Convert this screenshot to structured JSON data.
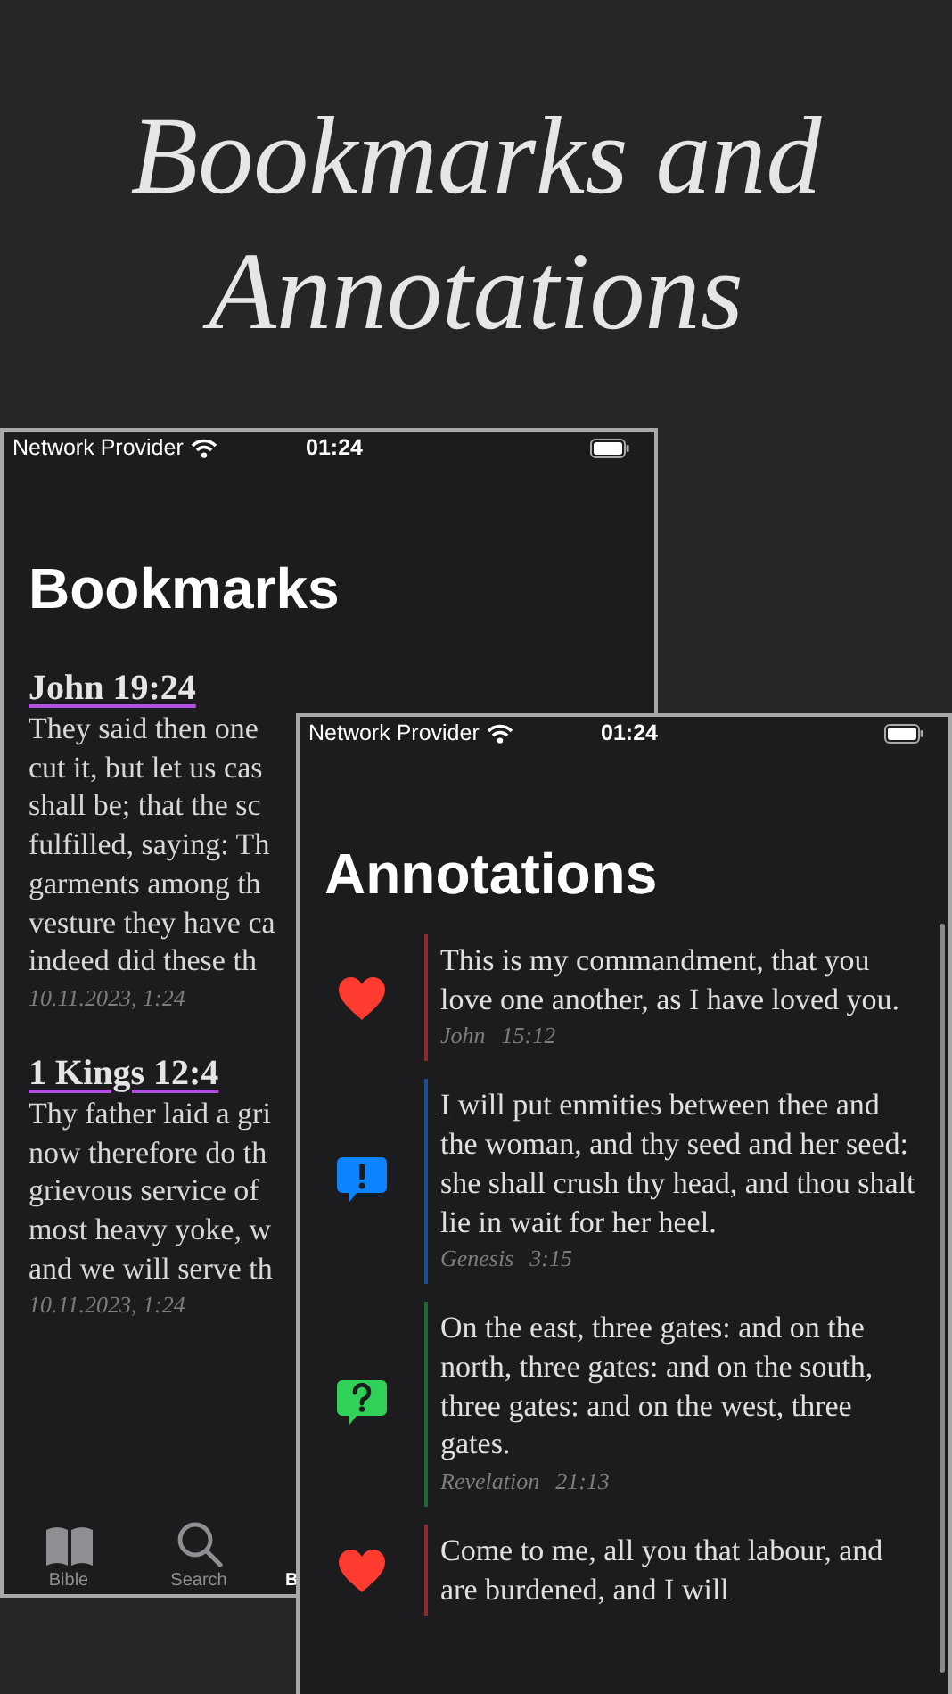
{
  "headline": "Bookmarks and Annotations",
  "bookmarks_screen": {
    "status_bar": {
      "carrier": "Network Provider",
      "time": "01:24"
    },
    "title": "Bookmarks",
    "bookmarks": [
      {
        "reference": "John  19:24",
        "color": "#af52de",
        "lines": [
          "They said then one",
          "cut it, but let us cas",
          "shall be; that the sc",
          "fulfilled, saying: Th",
          "garments among th",
          "vesture they have ca",
          "indeed did these th"
        ],
        "date": "10.11.2023, 1:24"
      },
      {
        "reference": "1 Kings  12:4",
        "color": "#af52de",
        "lines": [
          "Thy father laid a gri",
          "now therefore do th",
          "grievous service of",
          "most heavy yoke, w",
          "and we will serve th"
        ],
        "date": "10.11.2023, 1:24"
      }
    ],
    "tab_bar": [
      {
        "kind": "book",
        "label": "Bible"
      },
      {
        "kind": "search",
        "label": "Search"
      },
      {
        "kind": "hidden",
        "label": "B"
      }
    ]
  },
  "annotations_screen": {
    "status_bar": {
      "carrier": "Network Provider",
      "time": "01:24"
    },
    "title": "Annotations",
    "annotations": [
      {
        "kind": "heart",
        "color": "#8e2b2b",
        "text": "This is my commandment, that you love one another, as I have loved you.",
        "book": "John",
        "verse": "15:12"
      },
      {
        "kind": "exclamation",
        "color": "#1d4f95",
        "text": "I will put enmities between thee and the woman, and thy seed and her seed: she shall crush thy head, and thou shalt lie in wait for her heel.",
        "book": "Genesis",
        "verse": "3:15"
      },
      {
        "kind": "question",
        "color": "#1f6a30",
        "text": "On the east, three gates: and on the north, three gates: and on the south, three gates: and on the west, three gates.",
        "book": "Revelation",
        "verse": "21:13"
      },
      {
        "kind": "heart",
        "color": "#8e2b2b",
        "text": "Come to me, all you that labour, and are burdened, and I will"
      }
    ]
  }
}
